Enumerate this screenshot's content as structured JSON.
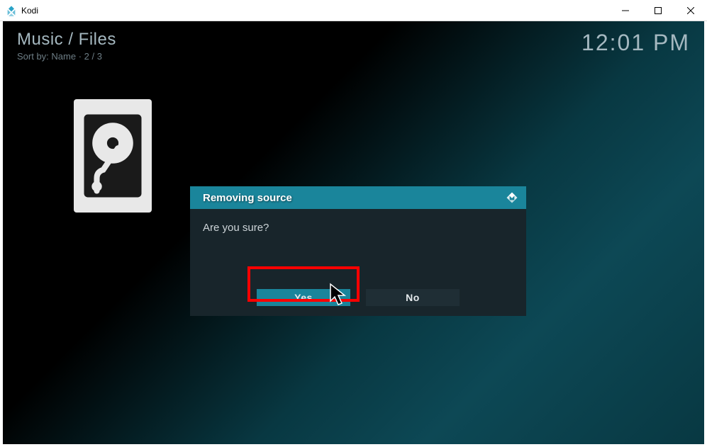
{
  "window": {
    "title": "Kodi"
  },
  "header": {
    "breadcrumb": "Music / Files",
    "sort_label": "Sort by: Name  ·  2 / 3",
    "clock": "12:01 PM"
  },
  "dialog": {
    "title": "Removing source",
    "message": "Are you sure?",
    "yes_label": "Yes",
    "no_label": "No"
  }
}
